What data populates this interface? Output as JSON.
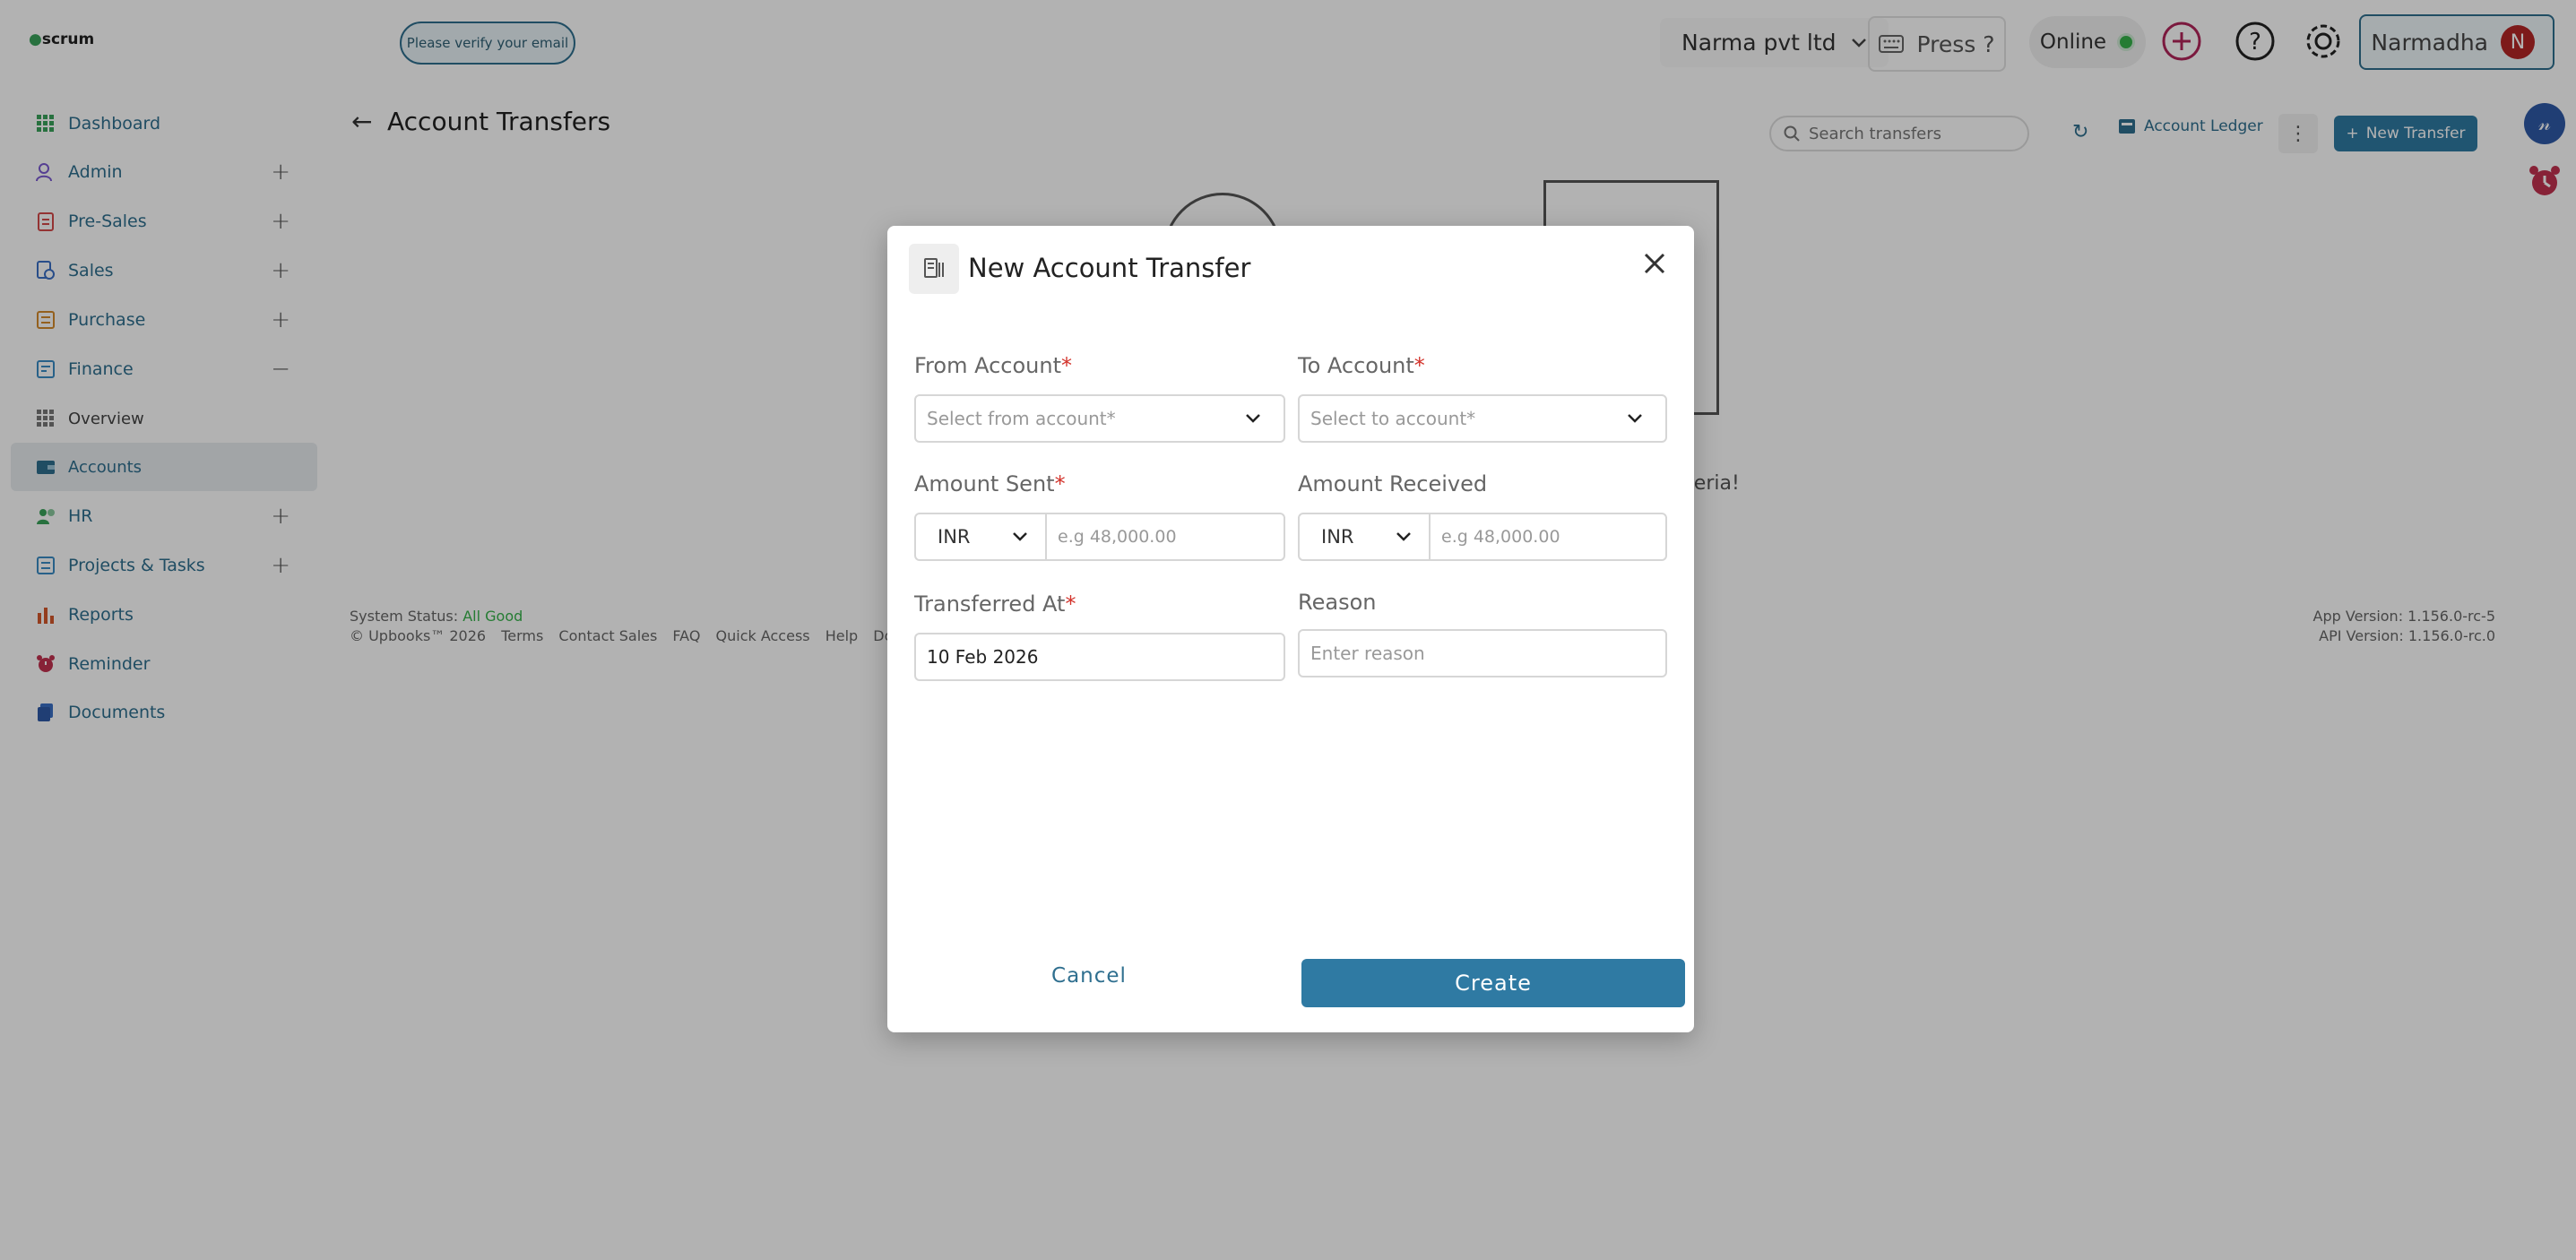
{
  "header": {
    "logo": "scrum",
    "verify_email": "Please verify your email",
    "org": "Narma pvt ltd",
    "press": "Press ?",
    "status": "Online",
    "user_name": "Narmadha",
    "user_initial": "N"
  },
  "sidebar": {
    "items": [
      {
        "label": "Dashboard"
      },
      {
        "label": "Admin"
      },
      {
        "label": "Pre-Sales"
      },
      {
        "label": "Sales"
      },
      {
        "label": "Purchase"
      },
      {
        "label": "Finance"
      },
      {
        "label": "Overview"
      },
      {
        "label": "Accounts"
      },
      {
        "label": "HR"
      },
      {
        "label": "Projects & Tasks"
      },
      {
        "label": "Reports"
      },
      {
        "label": "Reminder"
      },
      {
        "label": "Documents"
      }
    ]
  },
  "main": {
    "title": "Account Transfers",
    "search_placeholder": "Search transfers",
    "ledger_label": "Account Ledger",
    "new_transfer_label": "New Transfer",
    "empty_text_fragment": "riteria!"
  },
  "footer": {
    "status_label": "System Status:",
    "status_value": "All Good",
    "copyright": "© Upbooks™ 2026",
    "links": [
      "Terms",
      "Contact Sales",
      "FAQ",
      "Quick Access",
      "Help",
      "Docs"
    ],
    "app_version": "App Version: 1.156.0-rc-5",
    "api_version": "API Version: 1.156.0-rc.0"
  },
  "modal": {
    "title": "New Account Transfer",
    "from_account_label": "From Account",
    "from_account_placeholder": "Select from account*",
    "to_account_label": "To Account",
    "to_account_placeholder": "Select to account*",
    "amount_sent_label": "Amount Sent",
    "amount_sent_currency": "INR",
    "amount_sent_placeholder": "e.g 48,000.00",
    "amount_received_label": "Amount Received",
    "amount_received_currency": "INR",
    "amount_received_placeholder": "e.g 48,000.00",
    "transferred_at_label": "Transferred At",
    "transferred_at_value": "10 Feb 2026",
    "reason_label": "Reason",
    "reason_placeholder": "Enter reason",
    "required_mark": "*",
    "cancel_label": "Cancel",
    "create_label": "Create"
  },
  "colors": {
    "accent": "#2f7aa3",
    "nav_text": "#2f6f8f",
    "required": "#d3332b",
    "online": "#36b24a",
    "avatar": "#b32626"
  }
}
